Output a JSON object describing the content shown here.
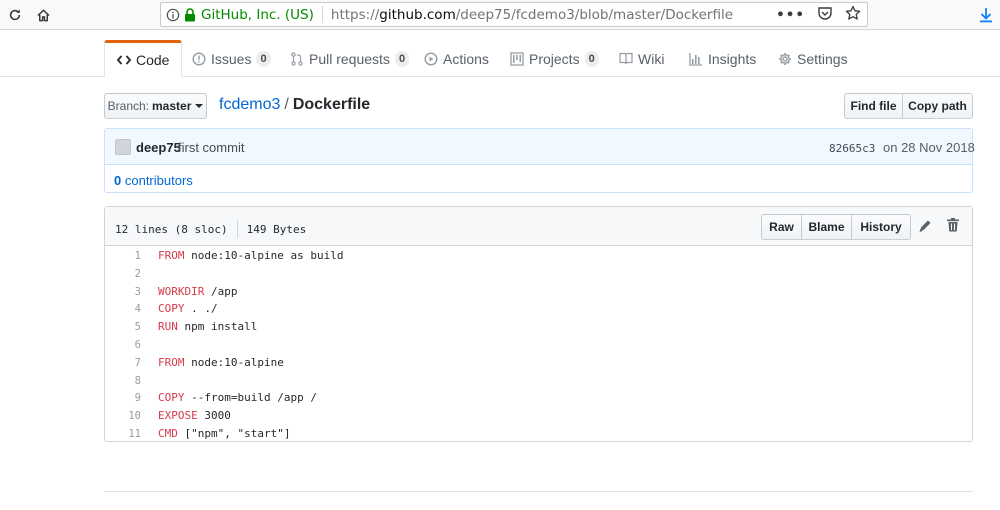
{
  "browser": {
    "org": "GitHub, Inc. (US)",
    "url_prefix": "https://",
    "url_host": "github.com",
    "url_path": "/deep75/fcdemo3/blob/master/Dockerfile"
  },
  "tabs": [
    {
      "label": "Code"
    },
    {
      "label": "Issues",
      "count": "0"
    },
    {
      "label": "Pull requests",
      "count": "0"
    },
    {
      "label": "Actions"
    },
    {
      "label": "Projects",
      "count": "0"
    },
    {
      "label": "Wiki"
    },
    {
      "label": "Insights"
    },
    {
      "label": "Settings"
    }
  ],
  "branch": {
    "label": "Branch:",
    "value": "master"
  },
  "breadcrumb": {
    "repo": "fcdemo3",
    "sep": "/",
    "file": "Dockerfile"
  },
  "buttons": {
    "find_file": "Find file",
    "copy_path": "Copy path",
    "raw": "Raw",
    "blame": "Blame",
    "history": "History"
  },
  "commit": {
    "author": "deep75",
    "message": "first commit",
    "sha": "82665c3",
    "date": "on 28 Nov 2018",
    "contributors_count": "0",
    "contributors_label": "contributors"
  },
  "file": {
    "lines_info": "12 lines (8 sloc)",
    "size": "149 Bytes"
  },
  "code_lines": [
    {
      "n": "1",
      "kw": "FROM",
      "rest": " node:10-alpine as build"
    },
    {
      "n": "2",
      "kw": "",
      "rest": ""
    },
    {
      "n": "3",
      "kw": "WORKDIR",
      "rest": " /app"
    },
    {
      "n": "4",
      "kw": "COPY",
      "rest": " . ./"
    },
    {
      "n": "5",
      "kw": "RUN",
      "rest": " npm install"
    },
    {
      "n": "6",
      "kw": "",
      "rest": ""
    },
    {
      "n": "7",
      "kw": "FROM",
      "rest": " node:10-alpine"
    },
    {
      "n": "8",
      "kw": "",
      "rest": ""
    },
    {
      "n": "9",
      "kw": "COPY",
      "rest": " --from=build /app /"
    },
    {
      "n": "10",
      "kw": "EXPOSE",
      "rest": " 3000"
    },
    {
      "n": "11",
      "kw": "CMD",
      "rest": " [\"npm\", \"start\"]"
    }
  ],
  "colors": {
    "accent": "#e36209",
    "link": "#0366d6",
    "keyword": "#d73a49",
    "secure": "#058b00"
  }
}
